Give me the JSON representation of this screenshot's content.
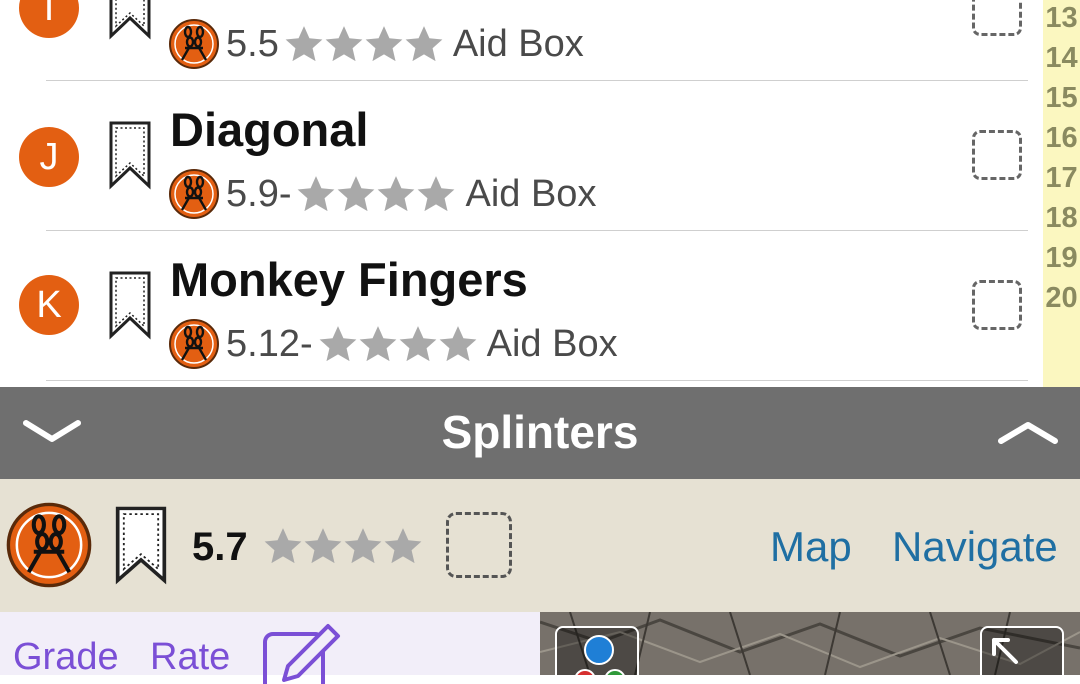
{
  "routes": [
    {
      "letter": "I",
      "name": "",
      "grade": "5.5",
      "type": "Aid Box"
    },
    {
      "letter": "J",
      "name": "Diagonal",
      "grade": "5.9-",
      "type": "Aid Box"
    },
    {
      "letter": "K",
      "name": "Monkey Fingers",
      "grade": "5.12-",
      "type": "Aid Box"
    }
  ],
  "index_numbers": [
    "13",
    "14",
    "15",
    "16",
    "17",
    "18",
    "19",
    "20"
  ],
  "header": {
    "title": "Splinters"
  },
  "detail": {
    "grade": "5.7",
    "map_label": "Map",
    "navigate_label": "Navigate"
  },
  "actions": {
    "grade_label": "Grade",
    "rate_label": "Rate"
  },
  "icons": {
    "collapse": "chevron-down-icon",
    "expand": "chevron-up-icon",
    "bookmark": "bookmark-icon",
    "edit": "pencil-icon",
    "fullscreen": "expand-arrows-icon"
  },
  "colors": {
    "accent": "#e35f12",
    "link": "#1f6fa3",
    "purple": "#7b4fd6",
    "bar": "#6f6f6f",
    "detail_bg": "#e6e1d3",
    "index_bg": "#fbf7c0"
  }
}
